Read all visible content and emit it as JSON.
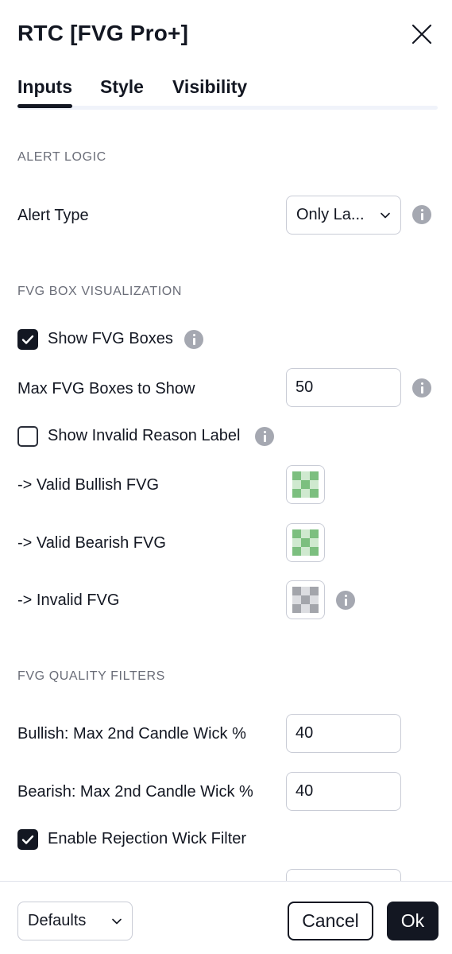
{
  "dialog": {
    "title": "RTC [FVG Pro+]"
  },
  "tabs": [
    {
      "label": "Inputs",
      "active": true
    },
    {
      "label": "Style",
      "active": false
    },
    {
      "label": "Visibility",
      "active": false
    }
  ],
  "sections": {
    "alert_logic": "ALERT LOGIC",
    "fvg_box": "FVG BOX VISUALIZATION",
    "quality": "FVG QUALITY FILTERS"
  },
  "alert_type": {
    "label": "Alert Type",
    "value": "Only La..."
  },
  "show_fvg_boxes": {
    "label": "Show FVG Boxes",
    "checked": true
  },
  "max_fvg_boxes": {
    "label": "Max FVG Boxes to Show",
    "value": "50"
  },
  "show_invalid_reason": {
    "label": "Show Invalid Reason Label",
    "checked": false
  },
  "colors": {
    "valid_bullish": {
      "label": "-> Valid Bullish FVG",
      "color": "#a5d6a7"
    },
    "valid_bearish": {
      "label": "-> Valid Bearish FVG",
      "color": "#a5d6a7"
    },
    "invalid": {
      "label": "-> Invalid FVG",
      "color": "#b2b5be"
    }
  },
  "bullish_wick": {
    "label": "Bullish: Max 2nd Candle Wick %",
    "value": "40"
  },
  "bearish_wick": {
    "label": "Bearish: Max 2nd Candle Wick %",
    "value": "40"
  },
  "rejection_wick": {
    "label": "Enable Rejection Wick Filter",
    "checked": true
  },
  "footer": {
    "defaults_label": "Defaults",
    "cancel_label": "Cancel",
    "ok_label": "Ok"
  },
  "theme": {
    "text": "#131722",
    "muted": "#6a6d78",
    "border": "#c9ccd6",
    "info": "#a5a8b1"
  }
}
